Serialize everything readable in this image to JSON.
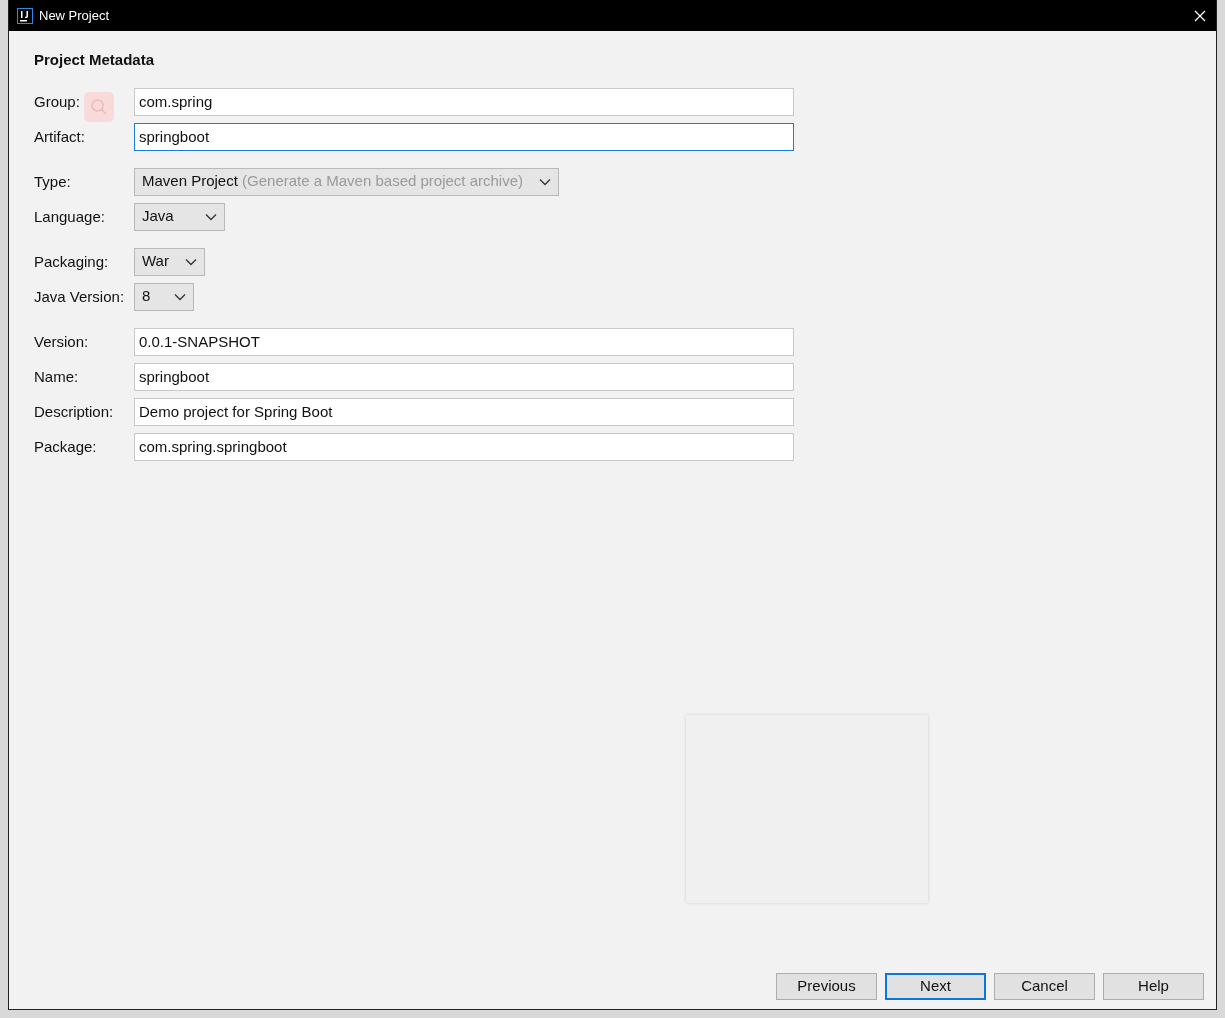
{
  "window": {
    "title": "New Project"
  },
  "section_title": "Project Metadata",
  "groups": [
    [
      {
        "label": "Group:",
        "kind": "text",
        "value": "com.spring",
        "focused": false
      },
      {
        "label": "Artifact:",
        "kind": "text",
        "value": "springboot",
        "focused": true
      }
    ],
    [
      {
        "label": "Type:",
        "kind": "select",
        "value": "Maven Project",
        "hint": "(Generate a Maven based project archive)"
      },
      {
        "label": "Language:",
        "kind": "select",
        "value": "Java"
      }
    ],
    [
      {
        "label": "Packaging:",
        "kind": "select",
        "value": "War"
      },
      {
        "label": "Java Version:",
        "kind": "select",
        "value": "8"
      }
    ],
    [
      {
        "label": "Version:",
        "kind": "text",
        "value": "0.0.1-SNAPSHOT",
        "focused": false
      },
      {
        "label": "Name:",
        "kind": "text",
        "value": "springboot",
        "focused": false
      },
      {
        "label": "Description:",
        "kind": "text",
        "value": "Demo project for Spring Boot",
        "focused": false
      },
      {
        "label": "Package:",
        "kind": "text",
        "value": "com.spring.springboot",
        "focused": false
      }
    ]
  ],
  "buttons": [
    {
      "label": "Previous",
      "default": false
    },
    {
      "label": "Next",
      "default": true
    },
    {
      "label": "Cancel",
      "default": false
    },
    {
      "label": "Help",
      "default": false
    }
  ]
}
